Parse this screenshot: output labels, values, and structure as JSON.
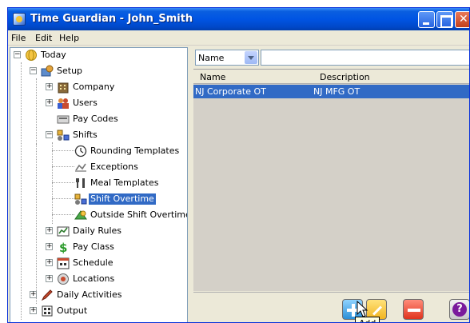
{
  "window": {
    "title": "Time Guardian - John_Smith"
  },
  "menu": [
    "File",
    "Edit",
    "Help"
  ],
  "tree": {
    "today": "Today",
    "setup": "Setup",
    "company": "Company",
    "users": "Users",
    "pay_codes": "Pay Codes",
    "shifts": "Shifts",
    "rounding_templates": "Rounding Templates",
    "exceptions": "Exceptions",
    "meal_templates": "Meal Templates",
    "shift_overtime": "Shift Overtime",
    "outside_shift_overtime": "Outside Shift Overtime",
    "daily_rules": "Daily Rules",
    "pay_class": "Pay Class",
    "schedule": "Schedule",
    "locations": "Locations",
    "daily_activities": "Daily Activities",
    "output": "Output"
  },
  "filter": {
    "field": "Name",
    "value": ""
  },
  "grid": {
    "columns": [
      "Name",
      "Description"
    ],
    "rows": [
      {
        "name": "NJ Corporate OT",
        "description": "NJ MFG OT"
      }
    ]
  },
  "tooltip": "Add",
  "colors": {
    "selection": "#316ac5",
    "titlebar": "#0054e3"
  }
}
